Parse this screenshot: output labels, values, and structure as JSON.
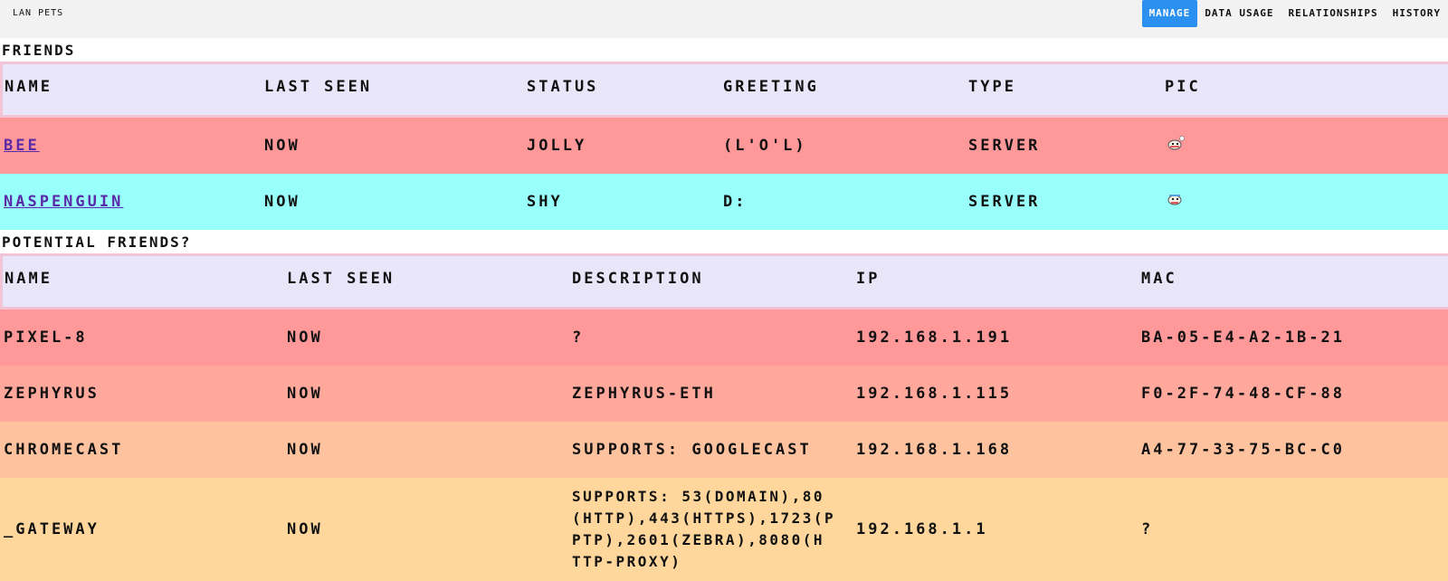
{
  "header": {
    "brand": "LAN PETS",
    "nav": [
      "MANAGE",
      "DATA USAGE",
      "RELATIONSHIPS",
      "HISTORY"
    ]
  },
  "friends": {
    "title": "FRIENDS",
    "columns": [
      "NAME",
      "LAST SEEN",
      "STATUS",
      "GREETING",
      "TYPE",
      "PIC"
    ],
    "rows": [
      {
        "name": "BEE",
        "last_seen": "NOW",
        "status": "JOLLY",
        "greeting": "(L'O'L)",
        "type": "SERVER",
        "pic": "pet-sprite-icon",
        "color": "#ff9899"
      },
      {
        "name": "NASPENGUIN",
        "last_seen": "NOW",
        "status": "SHY",
        "greeting": "D:",
        "type": "SERVER",
        "pic": "pet-sprite-icon",
        "color": "#99fffb"
      }
    ]
  },
  "potential": {
    "title": "POTENTIAL FRIENDS?",
    "columns": [
      "NAME",
      "LAST SEEN",
      "DESCRIPTION",
      "IP",
      "MAC"
    ],
    "rows": [
      {
        "name": "PIXEL-8",
        "last_seen": "NOW",
        "description": "?",
        "ip": "192.168.1.191",
        "mac": "BA-05-E4-A2-1B-21",
        "color": "#ff9899"
      },
      {
        "name": "ZEPHYRUS",
        "last_seen": "NOW",
        "description": "ZEPHYRUS-ETH",
        "ip": "192.168.1.115",
        "mac": "F0-2F-74-48-CF-88",
        "color": "#ffa89b"
      },
      {
        "name": "CHROMECAST",
        "last_seen": "NOW",
        "description": "SUPPORTS: GOOGLECAST",
        "ip": "192.168.1.168",
        "mac": "A4-77-33-75-BC-C0",
        "color": "#ffc29f"
      },
      {
        "name": "_GATEWAY",
        "last_seen": "NOW",
        "description": "SUPPORTS: 53(DOMAIN),80\n(HTTP),443(HTTPS),1723(P\nPTP),2601(ZEBRA),8080(H\nTTP-PROXY)",
        "ip": "192.168.1.1",
        "mac": "?",
        "color": "#ffd79c"
      }
    ]
  }
}
